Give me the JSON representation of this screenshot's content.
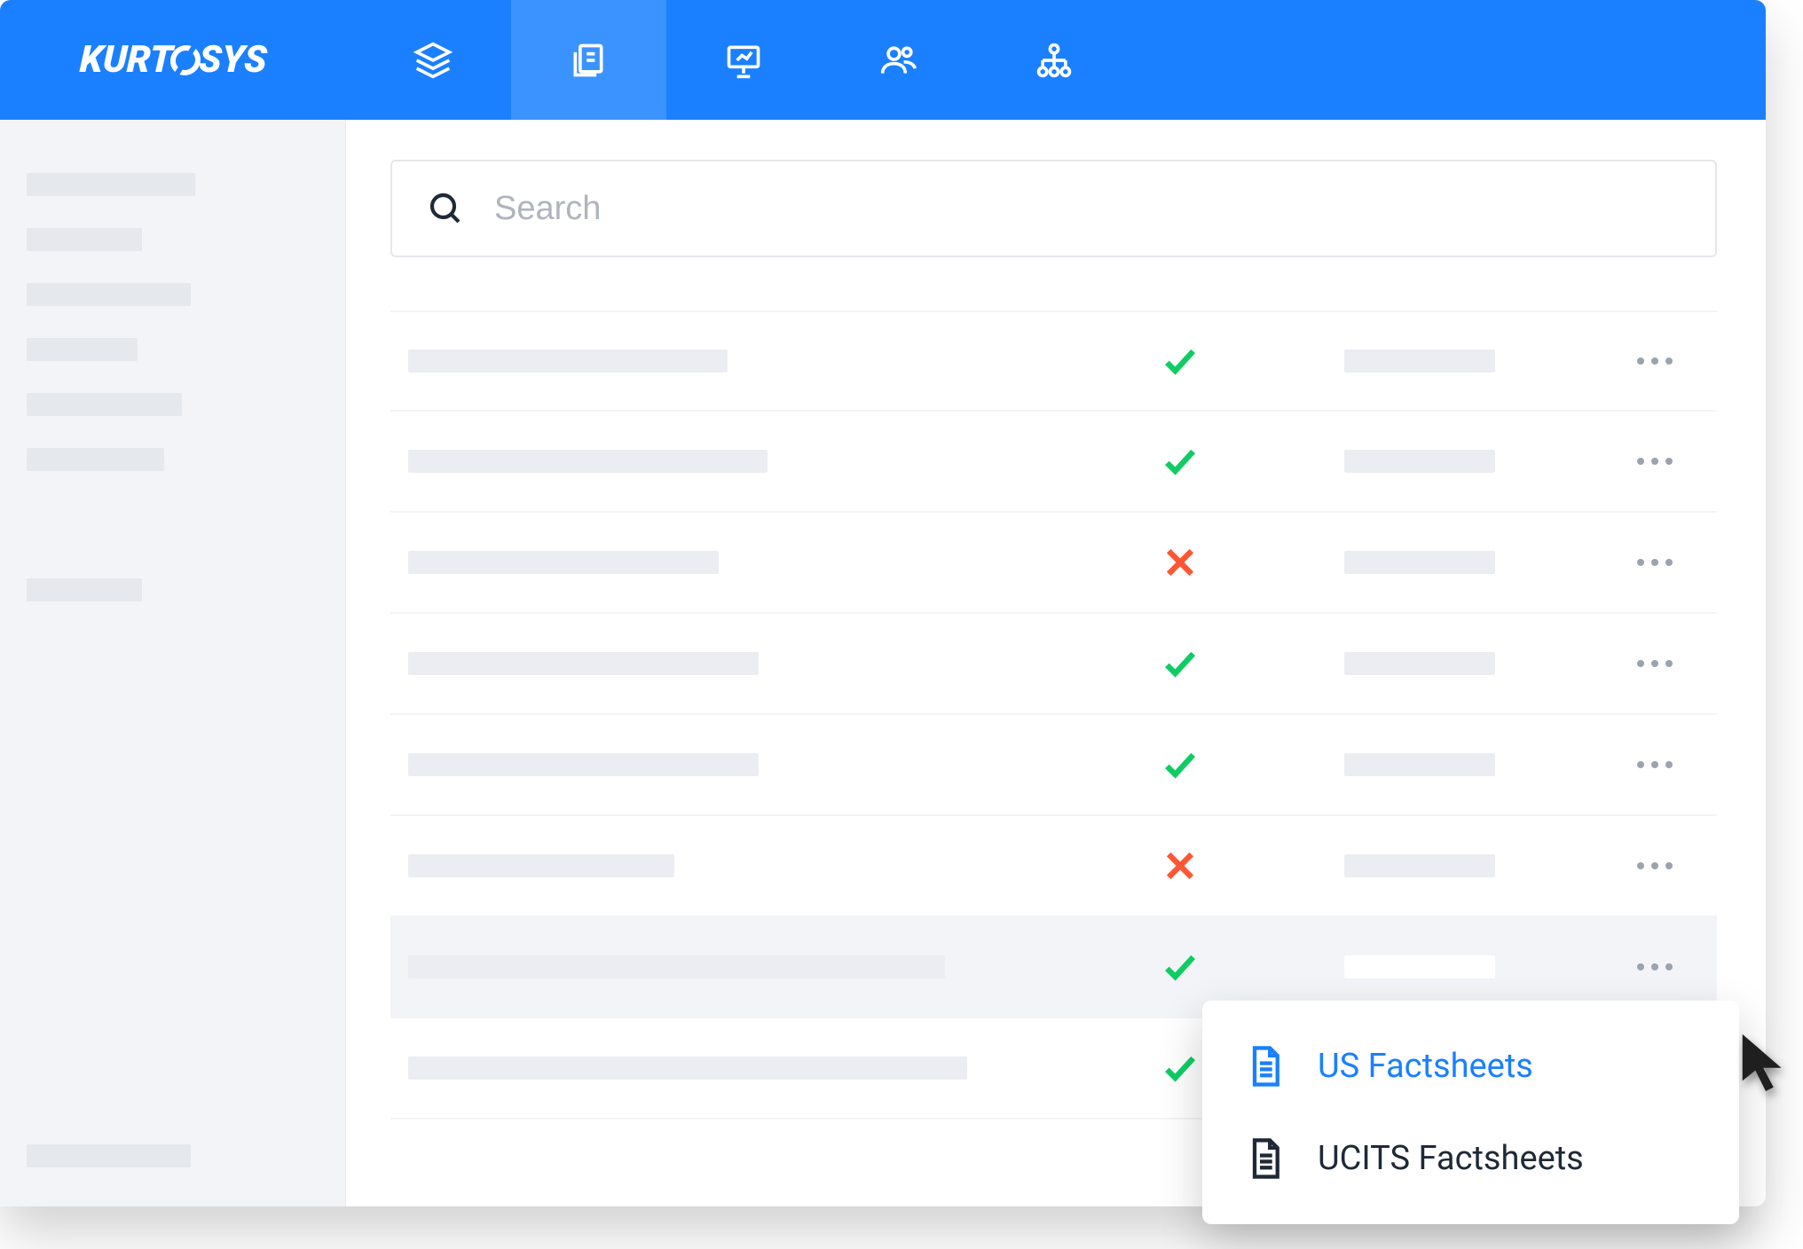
{
  "logo": "KURTOSYS",
  "search": {
    "placeholder": "Search"
  },
  "sidebar": {
    "items": [
      {
        "label": ""
      },
      {
        "label": ""
      },
      {
        "label": ""
      },
      {
        "label": ""
      },
      {
        "label": ""
      },
      {
        "label": ""
      }
    ],
    "secondItems": [
      {
        "label": ""
      }
    ],
    "bottomItem": {
      "label": ""
    }
  },
  "nav": {
    "items": [
      {
        "name": "layers",
        "active": false
      },
      {
        "name": "documents",
        "active": true
      },
      {
        "name": "presentation",
        "active": false
      },
      {
        "name": "users",
        "active": false
      },
      {
        "name": "hierarchy",
        "active": false
      }
    ]
  },
  "table": {
    "rows": [
      {
        "name": "",
        "status": "check",
        "date": ""
      },
      {
        "name": "",
        "status": "check",
        "date": ""
      },
      {
        "name": "",
        "status": "cross",
        "date": ""
      },
      {
        "name": "",
        "status": "check",
        "date": ""
      },
      {
        "name": "",
        "status": "check",
        "date": ""
      },
      {
        "name": "",
        "status": "cross",
        "date": ""
      },
      {
        "name": "",
        "status": "check",
        "date": "",
        "hovered": true
      },
      {
        "name": "",
        "status": "check",
        "date": ""
      }
    ]
  },
  "popup": {
    "items": [
      {
        "label": "US Factsheets",
        "highlighted": true
      },
      {
        "label": "UCITS Factsheets",
        "highlighted": false
      }
    ]
  }
}
